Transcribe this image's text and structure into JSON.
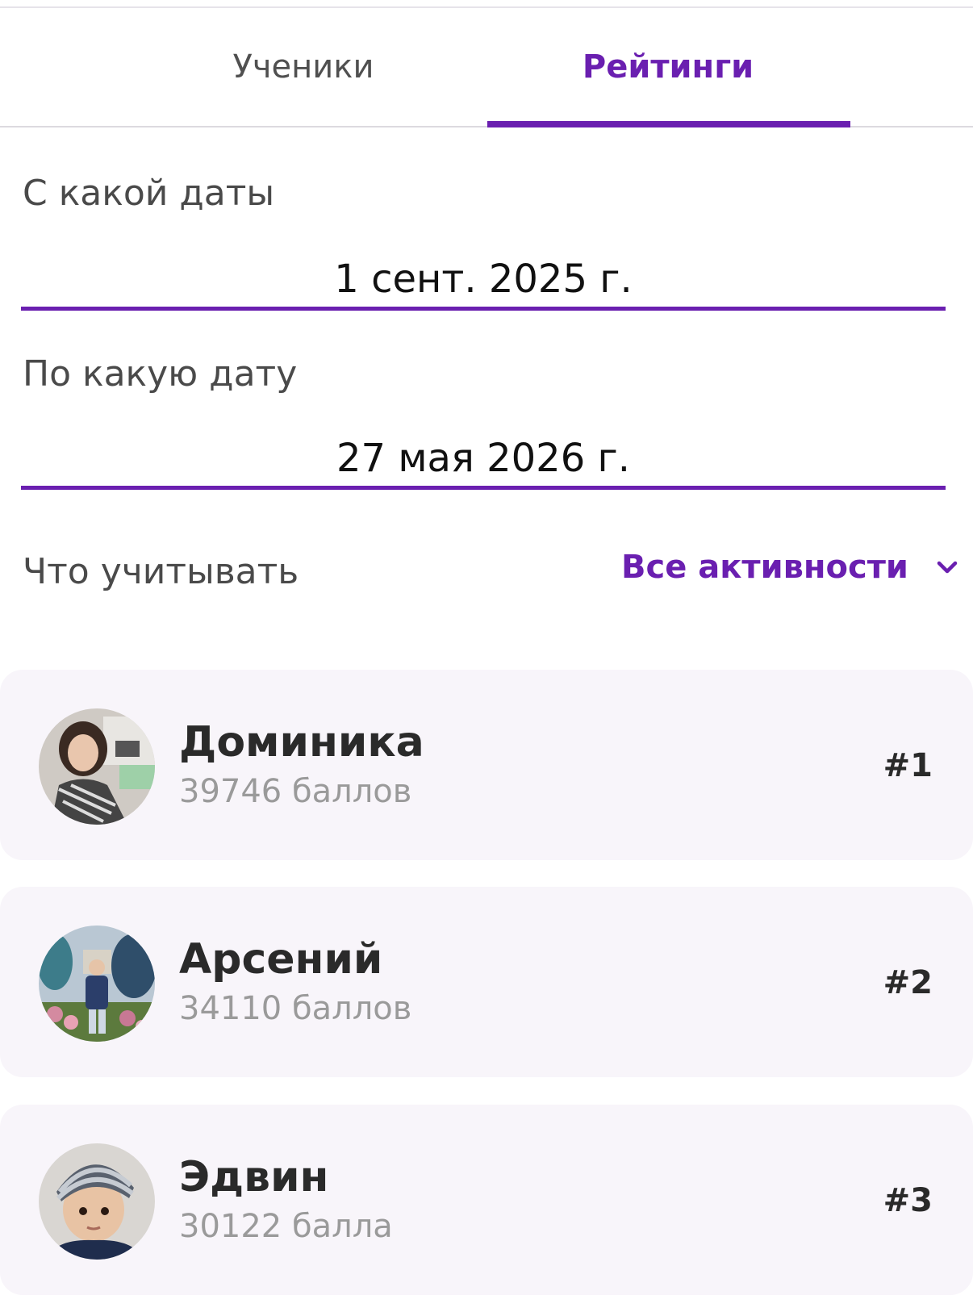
{
  "tabs": {
    "students_label": "Ученики",
    "ratings_label": "Рейтинги",
    "active": "ratings"
  },
  "date_from": {
    "label": "С какой даты",
    "value": "1 сент. 2025 г."
  },
  "date_to": {
    "label": "По какую дату",
    "value": "27 мая 2026 г."
  },
  "filter": {
    "label": "Что учитывать",
    "selected": "Все активности",
    "icon": "chevron-down-icon"
  },
  "students": [
    {
      "name": "Доминика",
      "points": "39746 баллов",
      "rank": "#1"
    },
    {
      "name": "Арсений",
      "points": "34110 баллов",
      "rank": "#2"
    },
    {
      "name": "Эдвин",
      "points": "30122 балла",
      "rank": "#3"
    }
  ],
  "colors": {
    "accent": "#6a1fb0",
    "card_bg": "#f8f5fa",
    "muted_text": "#9a9a9a"
  }
}
